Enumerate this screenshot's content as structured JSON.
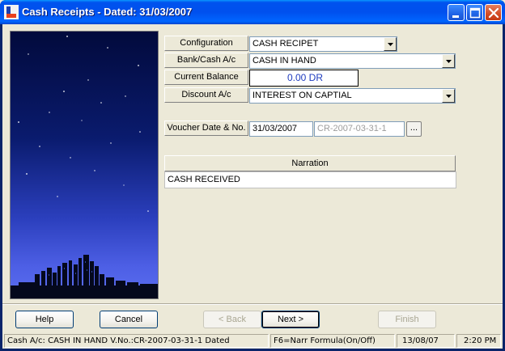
{
  "window": {
    "title": "Cash Receipts - Dated: 31/03/2007"
  },
  "form": {
    "configuration_label": "Configuration",
    "configuration_value": "CASH RECIPET",
    "bank_cash_label": "Bank/Cash A/c",
    "bank_cash_value": "CASH IN HAND",
    "balance_label": "Current Balance",
    "balance_value": "0.00 DR",
    "discount_label": "Discount A/c",
    "discount_value": "INTEREST ON CAPTIAL",
    "voucher_label": "Voucher Date & No.",
    "voucher_date": "31/03/2007",
    "voucher_no": "CR-2007-03-31-1",
    "browse_label": "...",
    "narration_header": "Narration",
    "narration_value": "CASH RECEIVED"
  },
  "buttons": {
    "help": "Help",
    "cancel": "Cancel",
    "back": "< Back",
    "next": "Next >",
    "finish": "Finish"
  },
  "status": {
    "info": "Cash A/c: CASH IN HAND V.No.:CR-2007-03-31-1 Dated",
    "hint": "F6=Narr Formula(On/Off)",
    "date": "13/08/07",
    "time": "2:20 PM"
  },
  "colors": {
    "titlebar": "#0054e3",
    "balance_text": "#1f3cbf",
    "close_button": "#d24b25"
  }
}
